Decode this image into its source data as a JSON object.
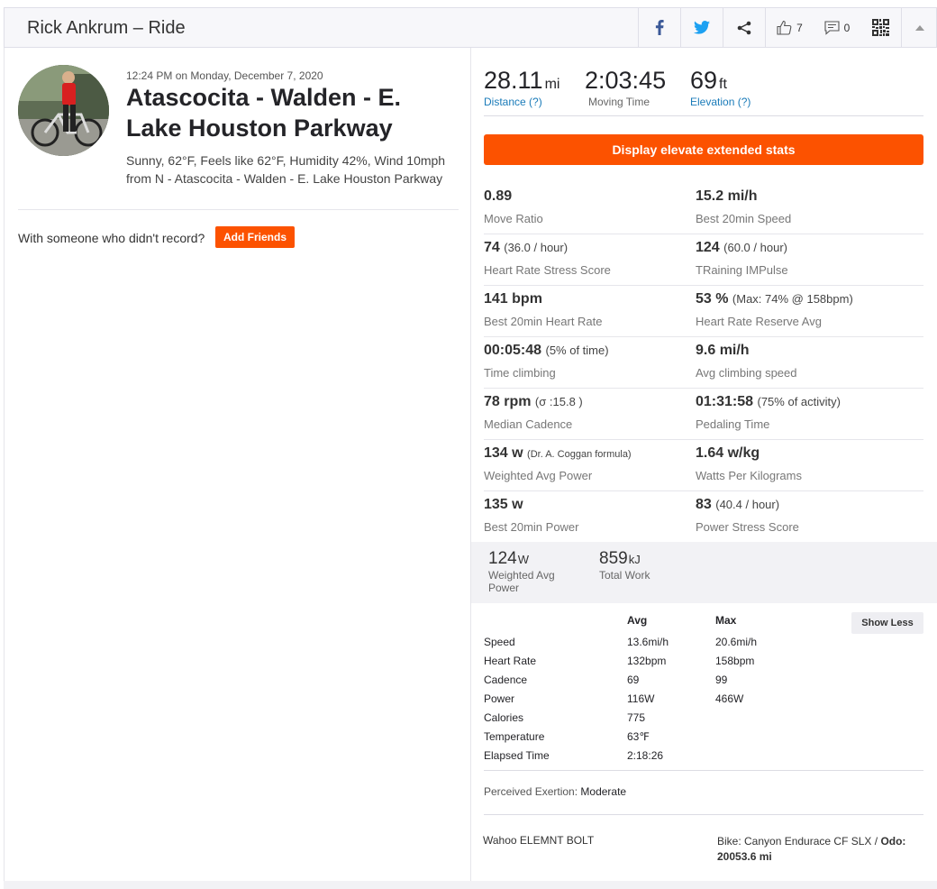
{
  "header": {
    "title": "Rick Ankrum – Ride",
    "kudos_count": "7",
    "comments_count": "0"
  },
  "activity": {
    "timestamp_time": "12:24 PM",
    "timestamp_on": "on Monday, December 7, 2020",
    "name": "Atascocita - Walden - E. Lake Houston Parkway",
    "description": "Sunny, 62°F, Feels like 62°F, Humidity 42%, Wind 10mph from N - Atascocita - Walden - E. Lake Houston Parkway",
    "with_someone": "With someone who didn't record?",
    "add_friends_label": "Add Friends"
  },
  "primary_stats": [
    {
      "value": "28.11",
      "unit": "mi",
      "label": "Distance (?)"
    },
    {
      "value": "2:03:45",
      "unit": "",
      "label": "Moving Time"
    },
    {
      "value": "69",
      "unit": "ft",
      "label": "Elevation (?)"
    }
  ],
  "elevate_button_label": "Display elevate extended stats",
  "extended_stats": [
    [
      {
        "value": "0.89",
        "extra": "",
        "label": "Move Ratio"
      },
      {
        "value": "15.2 mi/h",
        "extra": "",
        "label": "Best 20min Speed"
      }
    ],
    [
      {
        "value": "74",
        "extra": "(36.0 / hour)",
        "label": "Heart Rate Stress Score"
      },
      {
        "value": "124",
        "extra": "(60.0 / hour)",
        "label": "TRaining IMPulse"
      }
    ],
    [
      {
        "value": "141 bpm",
        "extra": "",
        "label": "Best 20min Heart Rate"
      },
      {
        "value": "53 %",
        "extra": "(Max: 74% @ 158bpm)",
        "label": "Heart Rate Reserve Avg"
      }
    ],
    [
      {
        "value": "00:05:48",
        "extra": "(5% of time)",
        "label": "Time climbing"
      },
      {
        "value": "9.6 mi/h",
        "extra": "",
        "label": "Avg climbing speed"
      }
    ],
    [
      {
        "value": "78 rpm",
        "extra": "(σ :15.8 )",
        "label": "Median Cadence"
      },
      {
        "value": "01:31:58",
        "extra": "(75% of activity)",
        "label": "Pedaling Time"
      }
    ],
    [
      {
        "value": "134 w",
        "extra": "(Dr. A. Coggan formula)",
        "label": "Weighted Avg Power"
      },
      {
        "value": "1.64 w/kg",
        "extra": "",
        "label": "Watts Per Kilograms"
      }
    ],
    [
      {
        "value": "135 w",
        "extra": "",
        "label": "Best 20min Power"
      },
      {
        "value": "83",
        "extra": "(40.4 / hour)",
        "label": "Power Stress Score"
      }
    ]
  ],
  "power_summary": [
    {
      "value": "124",
      "unit": "W",
      "label": "Weighted Avg Power"
    },
    {
      "value": "859",
      "unit": "kJ",
      "label": "Total Work"
    }
  ],
  "details": {
    "avg_header": "Avg",
    "max_header": "Max",
    "show_less_label": "Show Less",
    "rows": [
      {
        "label": "Speed",
        "avg": "13.6mi/h",
        "max": "20.6mi/h"
      },
      {
        "label": "Heart Rate",
        "avg": "132bpm",
        "max": "158bpm"
      },
      {
        "label": "Cadence",
        "avg": "69",
        "max": "99"
      },
      {
        "label": "Power",
        "avg": "116W",
        "max": "466W"
      },
      {
        "label": "Calories",
        "avg": "775",
        "max": ""
      },
      {
        "label": "Temperature",
        "avg": "63℉",
        "max": ""
      },
      {
        "label": "Elapsed Time",
        "avg": "2:18:26",
        "max": ""
      }
    ]
  },
  "perceived_exertion_label": "Perceived Exertion:",
  "perceived_exertion_value": "Moderate",
  "device": "Wahoo ELEMNT BOLT",
  "bike_text": "Bike: Canyon Endurace CF SLX /",
  "odo_text": "Odo: 20053.6 mi",
  "colors": {
    "accent": "#fc5200",
    "link": "#1a7bb9"
  }
}
